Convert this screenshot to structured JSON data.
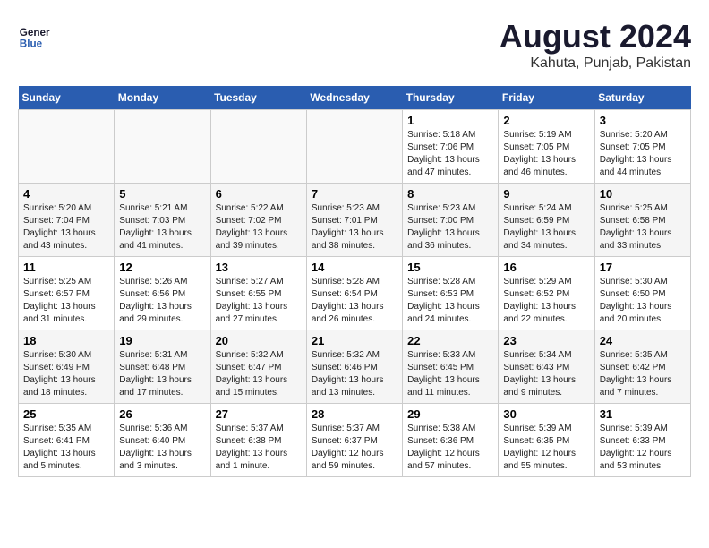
{
  "header": {
    "logo_line1": "General",
    "logo_line2": "Blue",
    "month_year": "August 2024",
    "location": "Kahuta, Punjab, Pakistan"
  },
  "weekdays": [
    "Sunday",
    "Monday",
    "Tuesday",
    "Wednesday",
    "Thursday",
    "Friday",
    "Saturday"
  ],
  "weeks": [
    [
      {
        "day": "",
        "info": ""
      },
      {
        "day": "",
        "info": ""
      },
      {
        "day": "",
        "info": ""
      },
      {
        "day": "",
        "info": ""
      },
      {
        "day": "1",
        "info": "Sunrise: 5:18 AM\nSunset: 7:06 PM\nDaylight: 13 hours\nand 47 minutes."
      },
      {
        "day": "2",
        "info": "Sunrise: 5:19 AM\nSunset: 7:05 PM\nDaylight: 13 hours\nand 46 minutes."
      },
      {
        "day": "3",
        "info": "Sunrise: 5:20 AM\nSunset: 7:05 PM\nDaylight: 13 hours\nand 44 minutes."
      }
    ],
    [
      {
        "day": "4",
        "info": "Sunrise: 5:20 AM\nSunset: 7:04 PM\nDaylight: 13 hours\nand 43 minutes."
      },
      {
        "day": "5",
        "info": "Sunrise: 5:21 AM\nSunset: 7:03 PM\nDaylight: 13 hours\nand 41 minutes."
      },
      {
        "day": "6",
        "info": "Sunrise: 5:22 AM\nSunset: 7:02 PM\nDaylight: 13 hours\nand 39 minutes."
      },
      {
        "day": "7",
        "info": "Sunrise: 5:23 AM\nSunset: 7:01 PM\nDaylight: 13 hours\nand 38 minutes."
      },
      {
        "day": "8",
        "info": "Sunrise: 5:23 AM\nSunset: 7:00 PM\nDaylight: 13 hours\nand 36 minutes."
      },
      {
        "day": "9",
        "info": "Sunrise: 5:24 AM\nSunset: 6:59 PM\nDaylight: 13 hours\nand 34 minutes."
      },
      {
        "day": "10",
        "info": "Sunrise: 5:25 AM\nSunset: 6:58 PM\nDaylight: 13 hours\nand 33 minutes."
      }
    ],
    [
      {
        "day": "11",
        "info": "Sunrise: 5:25 AM\nSunset: 6:57 PM\nDaylight: 13 hours\nand 31 minutes."
      },
      {
        "day": "12",
        "info": "Sunrise: 5:26 AM\nSunset: 6:56 PM\nDaylight: 13 hours\nand 29 minutes."
      },
      {
        "day": "13",
        "info": "Sunrise: 5:27 AM\nSunset: 6:55 PM\nDaylight: 13 hours\nand 27 minutes."
      },
      {
        "day": "14",
        "info": "Sunrise: 5:28 AM\nSunset: 6:54 PM\nDaylight: 13 hours\nand 26 minutes."
      },
      {
        "day": "15",
        "info": "Sunrise: 5:28 AM\nSunset: 6:53 PM\nDaylight: 13 hours\nand 24 minutes."
      },
      {
        "day": "16",
        "info": "Sunrise: 5:29 AM\nSunset: 6:52 PM\nDaylight: 13 hours\nand 22 minutes."
      },
      {
        "day": "17",
        "info": "Sunrise: 5:30 AM\nSunset: 6:50 PM\nDaylight: 13 hours\nand 20 minutes."
      }
    ],
    [
      {
        "day": "18",
        "info": "Sunrise: 5:30 AM\nSunset: 6:49 PM\nDaylight: 13 hours\nand 18 minutes."
      },
      {
        "day": "19",
        "info": "Sunrise: 5:31 AM\nSunset: 6:48 PM\nDaylight: 13 hours\nand 17 minutes."
      },
      {
        "day": "20",
        "info": "Sunrise: 5:32 AM\nSunset: 6:47 PM\nDaylight: 13 hours\nand 15 minutes."
      },
      {
        "day": "21",
        "info": "Sunrise: 5:32 AM\nSunset: 6:46 PM\nDaylight: 13 hours\nand 13 minutes."
      },
      {
        "day": "22",
        "info": "Sunrise: 5:33 AM\nSunset: 6:45 PM\nDaylight: 13 hours\nand 11 minutes."
      },
      {
        "day": "23",
        "info": "Sunrise: 5:34 AM\nSunset: 6:43 PM\nDaylight: 13 hours\nand 9 minutes."
      },
      {
        "day": "24",
        "info": "Sunrise: 5:35 AM\nSunset: 6:42 PM\nDaylight: 13 hours\nand 7 minutes."
      }
    ],
    [
      {
        "day": "25",
        "info": "Sunrise: 5:35 AM\nSunset: 6:41 PM\nDaylight: 13 hours\nand 5 minutes."
      },
      {
        "day": "26",
        "info": "Sunrise: 5:36 AM\nSunset: 6:40 PM\nDaylight: 13 hours\nand 3 minutes."
      },
      {
        "day": "27",
        "info": "Sunrise: 5:37 AM\nSunset: 6:38 PM\nDaylight: 13 hours\nand 1 minute."
      },
      {
        "day": "28",
        "info": "Sunrise: 5:37 AM\nSunset: 6:37 PM\nDaylight: 12 hours\nand 59 minutes."
      },
      {
        "day": "29",
        "info": "Sunrise: 5:38 AM\nSunset: 6:36 PM\nDaylight: 12 hours\nand 57 minutes."
      },
      {
        "day": "30",
        "info": "Sunrise: 5:39 AM\nSunset: 6:35 PM\nDaylight: 12 hours\nand 55 minutes."
      },
      {
        "day": "31",
        "info": "Sunrise: 5:39 AM\nSunset: 6:33 PM\nDaylight: 12 hours\nand 53 minutes."
      }
    ]
  ]
}
